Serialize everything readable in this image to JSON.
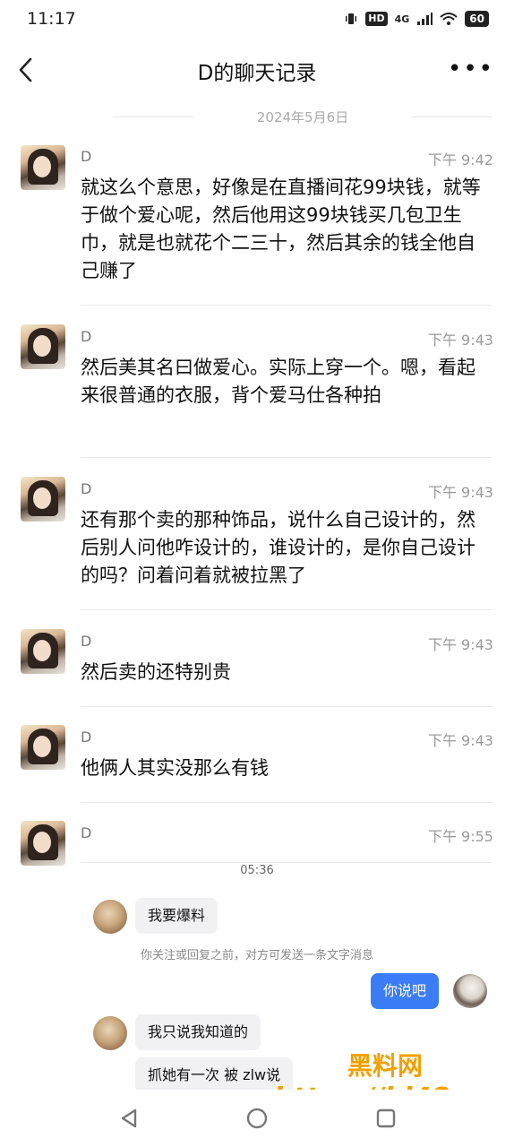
{
  "status": {
    "time": "11:17",
    "hd": "HD",
    "network": "4G",
    "battery": "60"
  },
  "header": {
    "title": "D的聊天记录"
  },
  "date_divider": "2024年5月6日",
  "messages": [
    {
      "name": "D",
      "time": "下午 9:42",
      "text": "就这么个意思，好像是在直播间花99块钱，就等于做个爱心呢，然后他用这99块钱买几包卫生巾，就是也就花个二三十，然后其余的钱全他自己赚了"
    },
    {
      "name": "D",
      "time": "下午 9:43",
      "text": "然后美其名曰做爱心。实际上穿一个。嗯，看起来很普通的衣服，背个爱马仕各种拍"
    },
    {
      "name": "D",
      "time": "下午 9:43",
      "text": "还有那个卖的那种饰品，说什么自己设计的，然后别人问他咋设计的，谁设计的，是你自己设计的吗？问着问着就被拉黑了"
    },
    {
      "name": "D",
      "time": "下午 9:43",
      "text": "然后卖的还特别贵"
    },
    {
      "name": "D",
      "time": "下午 9:43",
      "text": "他俩人其实没那么有钱"
    },
    {
      "name": "D",
      "time": "下午 9:55",
      "text": ""
    }
  ],
  "embedded": {
    "time": "05:36",
    "bubble1": "我要爆料",
    "notice": "你关注或回复之前，对方可发送一条文字消息",
    "my_reply": "你说吧",
    "bubble2": "我只说我知道的",
    "bubble3": "抓她有一次 被 zlw说"
  },
  "watermark": {
    "line1": "黑料网",
    "line2": "https://hl48.co"
  }
}
